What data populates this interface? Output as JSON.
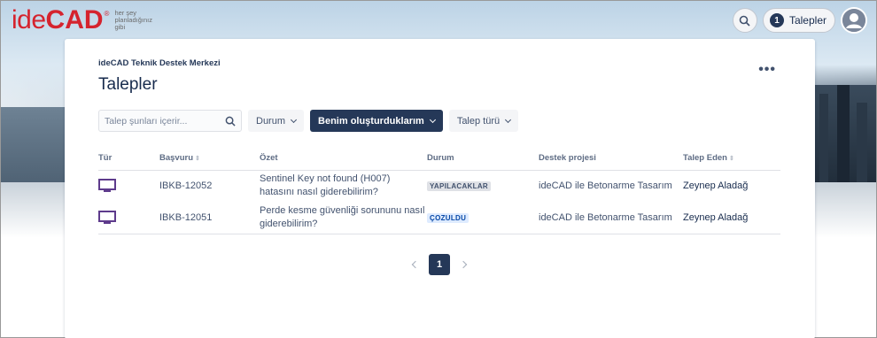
{
  "header": {
    "logo_ide": "ide",
    "logo_cad": "CAD",
    "logo_registered": "®",
    "logo_tagline": "her şey planladığınız gibi",
    "requests_count": "1",
    "requests_label": "Talepler"
  },
  "page": {
    "breadcrumb": "ideCAD Teknik Destek Merkezi",
    "title": "Talepler",
    "more_label": "•••"
  },
  "filters": {
    "search_placeholder": "Talep şunları içerir...",
    "status_label": "Durum",
    "created_by_me_label": "Benim oluşturduklarım",
    "request_type_label": "Talep türü"
  },
  "table": {
    "columns": {
      "type": "Tür",
      "reference": "Başvuru",
      "summary": "Özet",
      "status": "Durum",
      "project": "Destek projesi",
      "reporter": "Talep Eden"
    },
    "rows": [
      {
        "reference": "IBKB-12052",
        "summary": "Sentinel Key not found (H007) hatasını nasıl giderebilirim?",
        "status": "YAPILACAKLAR",
        "project": "ideCAD ile Betonarme Tasarım",
        "reporter": "Zeynep Aladağ"
      },
      {
        "reference": "IBKB-12051",
        "summary": "Perde kesme güvenliği sorununu nasıl giderebilirim?",
        "status": "ÇOZULDU",
        "project": "ideCAD ile Betonarme Tasarım",
        "reporter": "Zeynep Aladağ"
      }
    ]
  },
  "pagination": {
    "current_page": "1"
  },
  "colors": {
    "brand_red": "#d5232e",
    "primary_dark": "#253858",
    "type_icon": "#5e3b8c"
  }
}
